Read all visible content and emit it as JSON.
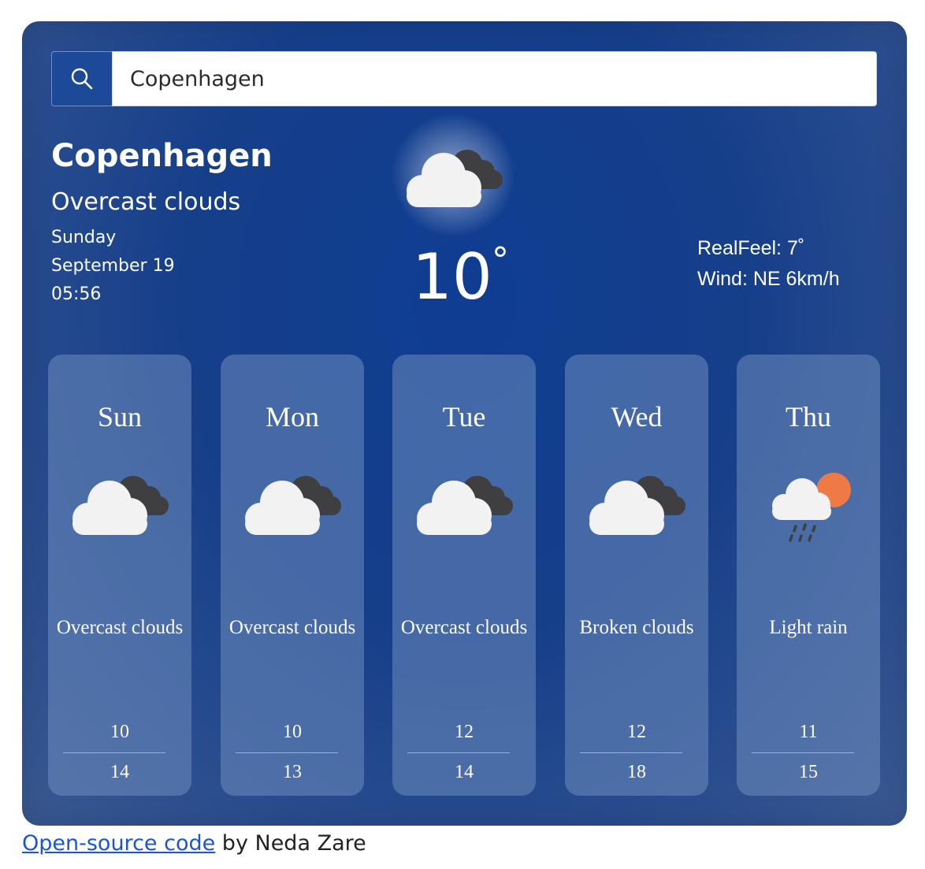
{
  "search": {
    "value": "Copenhagen"
  },
  "current": {
    "city": "Copenhagen",
    "description": "Overcast clouds",
    "day": "Sunday",
    "date": "September 19",
    "time": "05:56",
    "temperature": "10",
    "degree_symbol": "°",
    "realfeel": "RealFeel: 7˚",
    "wind": "Wind: NE 6km/h",
    "icon": "overcast-clouds-icon"
  },
  "forecast": [
    {
      "day": "Sun",
      "icon": "overcast-clouds-icon",
      "description": "Overcast clouds",
      "low": "10",
      "high": "14"
    },
    {
      "day": "Mon",
      "icon": "overcast-clouds-icon",
      "description": "Overcast clouds",
      "low": "10",
      "high": "13"
    },
    {
      "day": "Tue",
      "icon": "overcast-clouds-icon",
      "description": "Overcast clouds",
      "low": "12",
      "high": "14"
    },
    {
      "day": "Wed",
      "icon": "broken-clouds-icon",
      "description": "Broken clouds",
      "low": "12",
      "high": "18"
    },
    {
      "day": "Thu",
      "icon": "light-rain-icon",
      "description": "Light rain",
      "low": "11",
      "high": "15"
    }
  ],
  "footer": {
    "link_text": "Open-source code",
    "suffix": " by Neda Zare"
  },
  "colors": {
    "background": "#163f8a",
    "card": "#6e8cbe",
    "sun": "#f07a45",
    "cloud_front": "#f2f2f2",
    "cloud_back": "#3f3f42"
  }
}
